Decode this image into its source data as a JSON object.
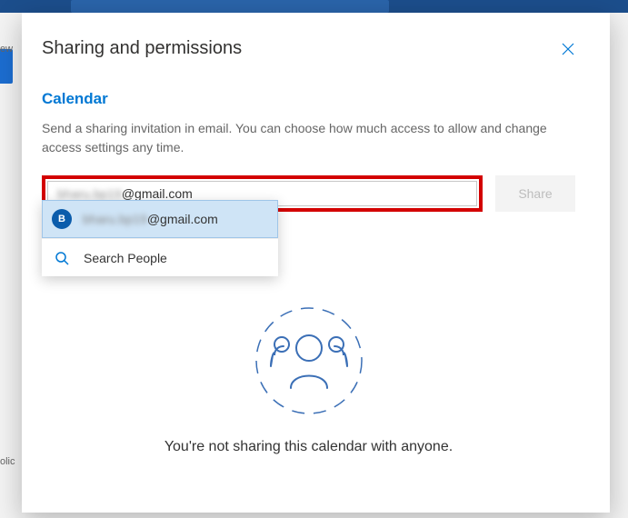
{
  "modal": {
    "title": "Sharing and permissions",
    "section_heading": "Calendar",
    "description": "Send a sharing invitation in email. You can choose how much access to allow and change access settings any time.",
    "share_button": "Share",
    "empty_state": "You're not sharing this calendar with anyone."
  },
  "input": {
    "value_visible_suffix": "@gmail.com",
    "value_obscured_prefix": "bharu.bp19"
  },
  "dropdown": {
    "contact": {
      "avatar_initial": "B",
      "obscured_prefix": "bharu.bp19",
      "visible_suffix": "@gmail.com"
    },
    "search_label": "Search People"
  },
  "background": {
    "left_label_1": "ew",
    "left_label_2": "olic"
  },
  "colors": {
    "accent": "#0078d4",
    "highlight_border": "#d30000",
    "header_bar": "#1c4e8c"
  }
}
